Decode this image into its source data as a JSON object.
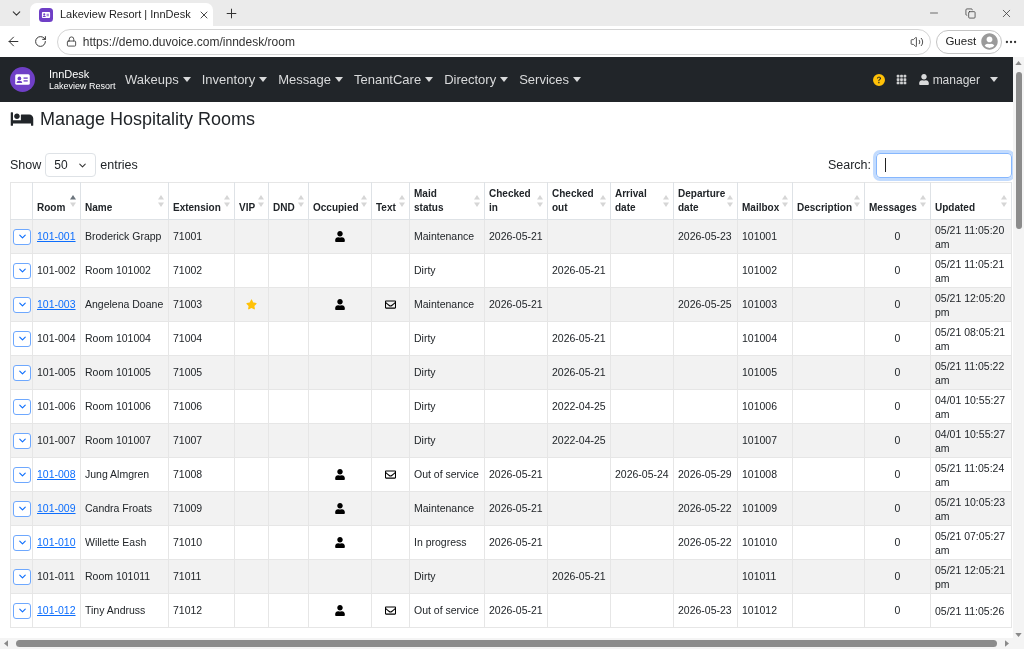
{
  "browser": {
    "tab_title": "Lakeview Resort | InnDesk",
    "url": "https://demo.duvoice.com/inndesk/room",
    "profile": "Guest"
  },
  "navbar": {
    "brand": "InnDesk",
    "subtitle": "Lakeview Resort",
    "menus": [
      {
        "label": "Wakeups"
      },
      {
        "label": "Inventory"
      },
      {
        "label": "Message"
      },
      {
        "label": "TenantCare"
      },
      {
        "label": "Directory"
      },
      {
        "label": "Services"
      }
    ],
    "user": "manager"
  },
  "page": {
    "title": "Manage Hospitality Rooms"
  },
  "length_menu": {
    "prefix": "Show",
    "value": "50",
    "suffix": "entries"
  },
  "search": {
    "label": "Search:",
    "focused": true
  },
  "table": {
    "columns": [
      {
        "label": "Room",
        "sorted": true
      },
      {
        "label": "Name",
        "sorted": false
      },
      {
        "label": "Extension",
        "sorted": false
      },
      {
        "label": "VIP",
        "sorted": false
      },
      {
        "label": "DND",
        "sorted": false
      },
      {
        "label": "Occupied",
        "sorted": false
      },
      {
        "label": "Text",
        "sorted": false
      },
      {
        "label": "Maid status",
        "sorted": false
      },
      {
        "label": "Checked in",
        "sorted": false
      },
      {
        "label": "Checked out",
        "sorted": false
      },
      {
        "label": "Arrival date",
        "sorted": false
      },
      {
        "label": "Departure date",
        "sorted": false
      },
      {
        "label": "Mailbox",
        "sorted": false
      },
      {
        "label": "Description",
        "sorted": false
      },
      {
        "label": "Messages",
        "sorted": false
      },
      {
        "label": "Updated",
        "sorted": false
      }
    ],
    "rows": [
      {
        "room": "101-001",
        "link": true,
        "name": "Broderick Grapp",
        "extension": "71001",
        "vip": false,
        "occupied": true,
        "text": false,
        "maid_status": "Maintenance",
        "checked_in": "2026-05-21",
        "departure_date": "2026-05-23",
        "mailbox": "101001",
        "messages": "0",
        "updated": "05/21 11:05:20 am"
      },
      {
        "room": "101-002",
        "link": false,
        "name": "Room 101002",
        "extension": "71002",
        "vip": false,
        "occupied": false,
        "text": false,
        "maid_status": "Dirty",
        "checked_out": "2026-05-21",
        "mailbox": "101002",
        "messages": "0",
        "updated": "05/21 11:05:21 am"
      },
      {
        "room": "101-003",
        "link": true,
        "name": "Angelena Doane",
        "extension": "71003",
        "vip": true,
        "occupied": true,
        "text": true,
        "maid_status": "Maintenance",
        "checked_in": "2026-05-21",
        "departure_date": "2026-05-25",
        "mailbox": "101003",
        "messages": "0",
        "updated": "05/21 12:05:20 pm"
      },
      {
        "room": "101-004",
        "link": false,
        "name": "Room 101004",
        "extension": "71004",
        "vip": false,
        "occupied": false,
        "text": false,
        "maid_status": "Dirty",
        "checked_out": "2026-05-21",
        "mailbox": "101004",
        "messages": "0",
        "updated": "05/21 08:05:21 am"
      },
      {
        "room": "101-005",
        "link": false,
        "name": "Room 101005",
        "extension": "71005",
        "vip": false,
        "occupied": false,
        "text": false,
        "maid_status": "Dirty",
        "checked_out": "2026-05-21",
        "mailbox": "101005",
        "messages": "0",
        "updated": "05/21 11:05:22 am"
      },
      {
        "room": "101-006",
        "link": false,
        "name": "Room 101006",
        "extension": "71006",
        "vip": false,
        "occupied": false,
        "text": false,
        "maid_status": "Dirty",
        "checked_out": "2022-04-25",
        "mailbox": "101006",
        "messages": "0",
        "updated": "04/01 10:55:27 am"
      },
      {
        "room": "101-007",
        "link": false,
        "name": "Room 101007",
        "extension": "71007",
        "vip": false,
        "occupied": false,
        "text": false,
        "maid_status": "Dirty",
        "checked_out": "2022-04-25",
        "mailbox": "101007",
        "messages": "0",
        "updated": "04/01 10:55:27 am"
      },
      {
        "room": "101-008",
        "link": true,
        "name": "Jung Almgren",
        "extension": "71008",
        "vip": false,
        "occupied": true,
        "text": true,
        "maid_status": "Out of service",
        "checked_in": "2026-05-21",
        "arrival_date": "2026-05-24",
        "departure_date": "2026-05-29",
        "mailbox": "101008",
        "messages": "0",
        "updated": "05/21 11:05:24 am"
      },
      {
        "room": "101-009",
        "link": true,
        "name": "Candra Froats",
        "extension": "71009",
        "vip": false,
        "occupied": true,
        "text": false,
        "maid_status": "Maintenance",
        "checked_in": "2026-05-21",
        "departure_date": "2026-05-22",
        "mailbox": "101009",
        "messages": "0",
        "updated": "05/21 10:05:23 am"
      },
      {
        "room": "101-010",
        "link": true,
        "name": "Willette Eash",
        "extension": "71010",
        "vip": false,
        "occupied": true,
        "text": false,
        "maid_status": "In progress",
        "checked_in": "2026-05-21",
        "departure_date": "2026-05-22",
        "mailbox": "101010",
        "messages": "0",
        "updated": "05/21 07:05:27 am"
      },
      {
        "room": "101-011",
        "link": false,
        "name": "Room 101011",
        "extension": "71011",
        "vip": false,
        "occupied": false,
        "text": false,
        "maid_status": "Dirty",
        "checked_out": "2026-05-21",
        "mailbox": "101011",
        "messages": "0",
        "updated": "05/21 12:05:21 pm"
      },
      {
        "room": "101-012",
        "link": true,
        "name": "Tiny Andruss",
        "extension": "71012",
        "vip": false,
        "occupied": true,
        "text": true,
        "maid_status": "Out of service",
        "checked_in": "2026-05-21",
        "departure_date": "2026-05-23",
        "mailbox": "101012",
        "messages": "0",
        "updated": "05/21 11:05:26"
      }
    ]
  }
}
